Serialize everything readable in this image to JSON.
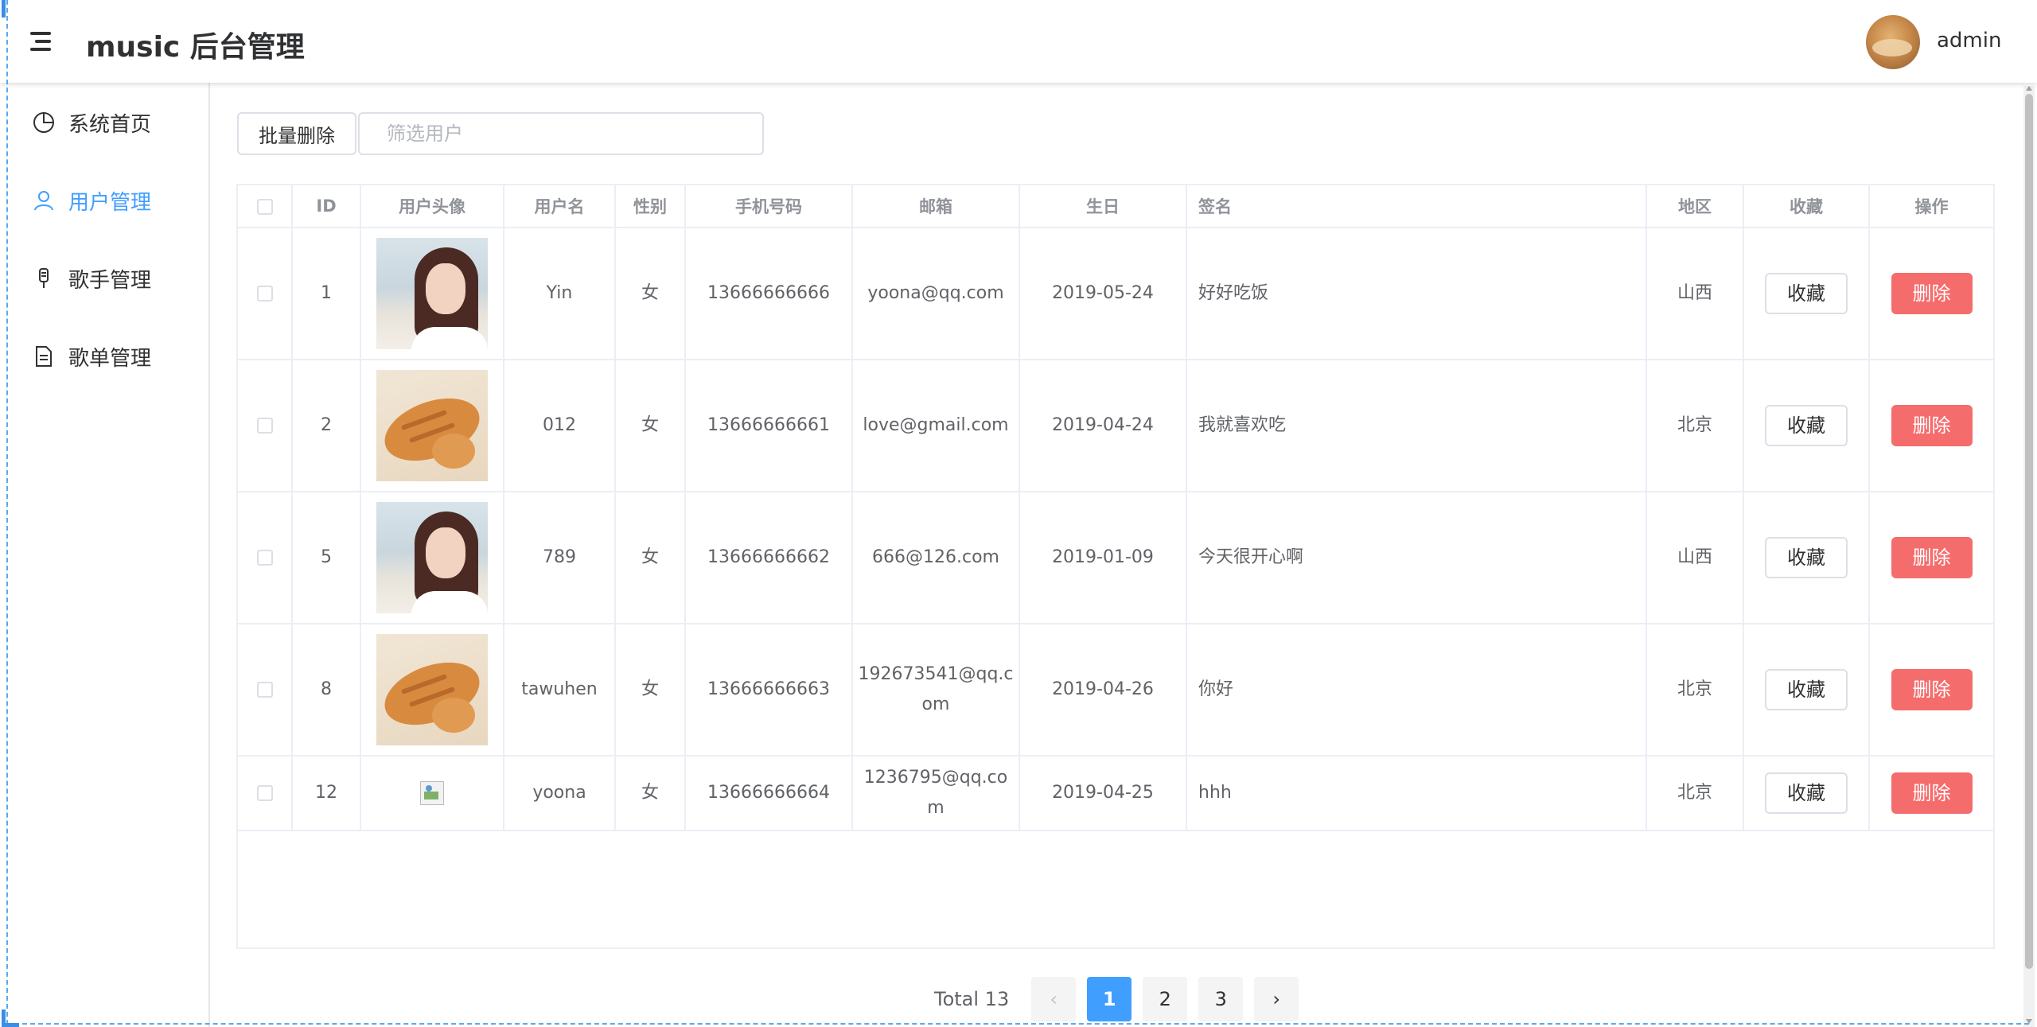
{
  "header": {
    "title": "music 后台管理",
    "user_name": "admin"
  },
  "sidebar": {
    "items": [
      {
        "label": "系统首页",
        "icon": "pie-chart-icon",
        "active": false
      },
      {
        "label": "用户管理",
        "icon": "user-icon",
        "active": true
      },
      {
        "label": "歌手管理",
        "icon": "microphone-icon",
        "active": false
      },
      {
        "label": "歌单管理",
        "icon": "document-icon",
        "active": false
      }
    ]
  },
  "toolbar": {
    "batch_delete_label": "批量删除",
    "search_placeholder": "筛选用户",
    "search_value": ""
  },
  "table": {
    "headers": [
      "",
      "ID",
      "用户头像",
      "用户名",
      "性别",
      "手机号码",
      "邮箱",
      "生日",
      "签名",
      "地区",
      "收藏",
      "操作"
    ],
    "rows": [
      {
        "id": "1",
        "avatar": "girl-photo",
        "name": "Yin",
        "sex": "女",
        "phone": "13666666666",
        "email": "yoona@qq.com",
        "birth": "2019-05-24",
        "sign": "好好吃饭",
        "region": "山西",
        "fav": "收藏",
        "del": "删除"
      },
      {
        "id": "2",
        "avatar": "cat-photo",
        "name": "012",
        "sex": "女",
        "phone": "13666666661",
        "email": "love@gmail.com",
        "birth": "2019-04-24",
        "sign": "我就喜欢吃",
        "region": "北京",
        "fav": "收藏",
        "del": "删除"
      },
      {
        "id": "5",
        "avatar": "girl-photo",
        "name": "789",
        "sex": "女",
        "phone": "13666666662",
        "email": "666@126.com",
        "birth": "2019-01-09",
        "sign": "今天很开心啊",
        "region": "山西",
        "fav": "收藏",
        "del": "删除"
      },
      {
        "id": "8",
        "avatar": "cat-photo",
        "name": "tawuhen",
        "sex": "女",
        "phone": "13666666663",
        "email": "192673541@qq.com",
        "birth": "2019-04-26",
        "sign": "你好",
        "region": "北京",
        "fav": "收藏",
        "del": "删除"
      },
      {
        "id": "12",
        "avatar": "broken-image",
        "name": "yoona",
        "sex": "女",
        "phone": "13666666664",
        "email": "1236795@qq.com",
        "birth": "2019-04-25",
        "sign": "hhh",
        "region": "北京",
        "fav": "收藏",
        "del": "删除"
      }
    ]
  },
  "pagination": {
    "total_label": "Total 13",
    "pages": [
      "1",
      "2",
      "3"
    ],
    "current": "1",
    "prev": "‹",
    "next": "›"
  },
  "colors": {
    "primary": "#409EFF",
    "danger": "#F56C6C"
  }
}
